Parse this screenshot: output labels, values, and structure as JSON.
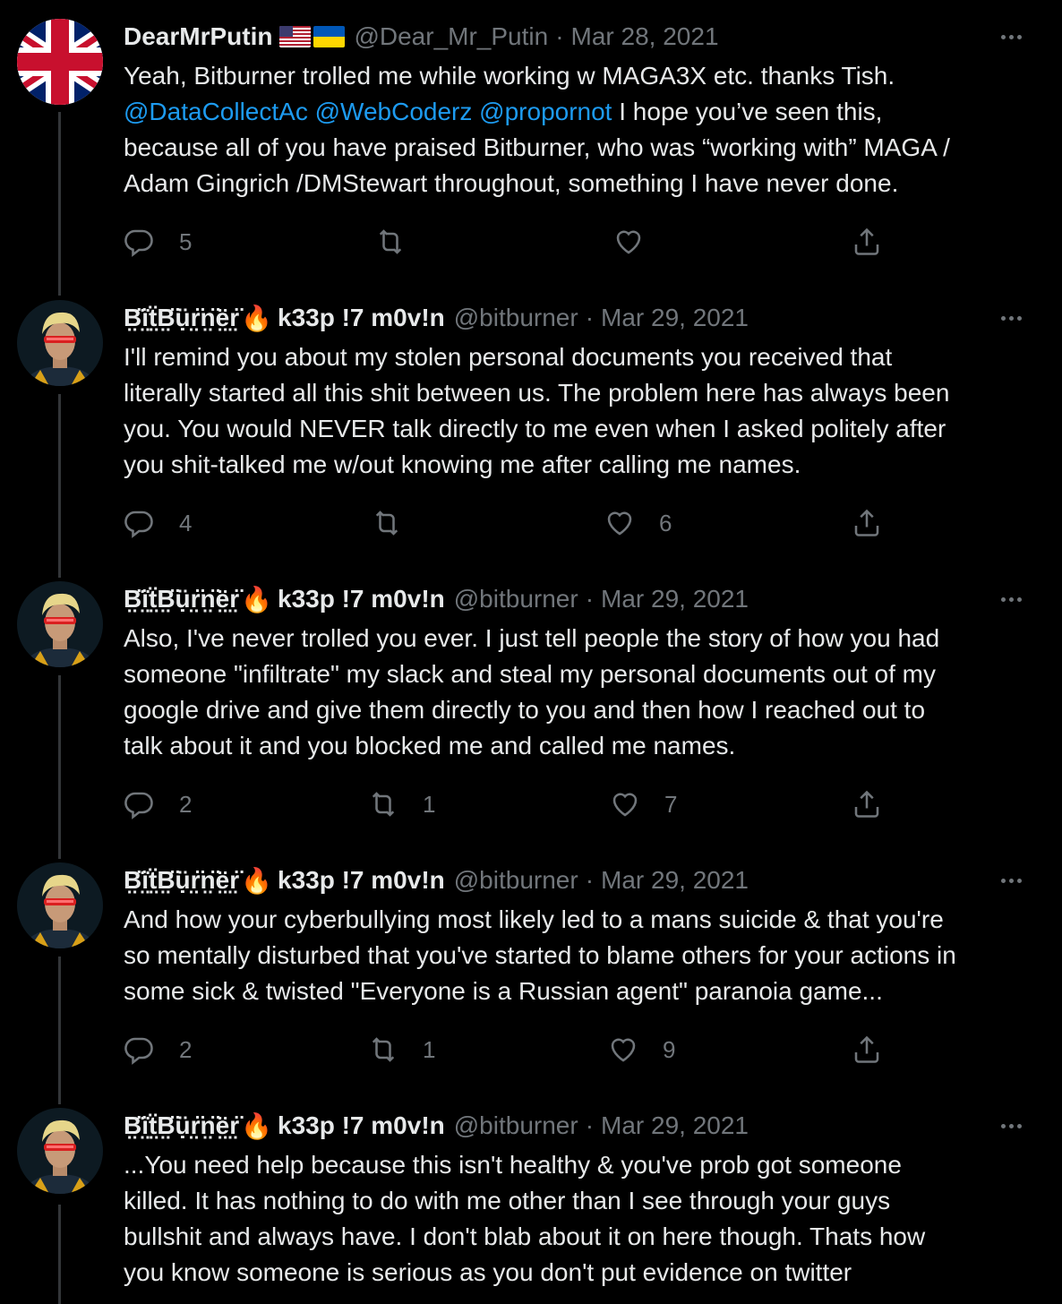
{
  "tweets": [
    {
      "name": "DearMrPutin",
      "handle": "@Dear_Mr_Putin",
      "separator": "·",
      "date": "Mar 28, 2021",
      "avatar": "uk-flag-avatar",
      "flags": [
        "us-flag-icon",
        "ukraine-flag-icon"
      ],
      "text_line1": "Yeah, Bitburner trolled me while working w MAGA3X etc. thanks Tish.",
      "mentions": [
        "@DataCollectAc",
        "@WebCoderz",
        "@propornot"
      ],
      "text_after_mentions": " I hope you’ve seen this,",
      "text_rest": "because all of you have praised Bitburner, who was “working with” MAGA /\nAdam Gingrich /DMStewart throughout, something I have never done.",
      "replies": "5",
      "retweets": "",
      "likes": ""
    },
    {
      "name": "B̤̈ï̤ẗ̤B̤̈ụ̈r̤̈n̤̈ë̤r̤̈",
      "nickname": "k33p !7 m0v!n",
      "handle": "@bitburner",
      "separator": "·",
      "date": "Mar 29, 2021",
      "avatar": "bitburner-avatar",
      "text": "I'll remind you about my stolen personal documents you received that\nliterally started all this shit between us. The problem here has always been\nyou. You would NEVER talk directly to me even when I asked politely after\nyou shit-talked me w/out knowing me after calling me names.",
      "replies": "4",
      "retweets": "",
      "likes": "6"
    },
    {
      "name": "B̤̈ï̤ẗ̤B̤̈ụ̈r̤̈n̤̈ë̤r̤̈",
      "nickname": "k33p !7 m0v!n",
      "handle": "@bitburner",
      "separator": "·",
      "date": "Mar 29, 2021",
      "avatar": "bitburner-avatar",
      "text": "Also, I've never trolled you ever. I just tell people the story of how you had\nsomeone \"infiltrate\" my slack and steal my personal documents out of my\ngoogle drive and give them directly to you and then how I reached out to\ntalk about it and you blocked me and called me names.",
      "replies": "2",
      "retweets": "1",
      "likes": "7"
    },
    {
      "name": "B̤̈ï̤ẗ̤B̤̈ụ̈r̤̈n̤̈ë̤r̤̈",
      "nickname": "k33p !7 m0v!n",
      "handle": "@bitburner",
      "separator": "·",
      "date": "Mar 29, 2021",
      "avatar": "bitburner-avatar",
      "text": "And how your cyberbullying most likely led to a mans suicide & that you're\nso mentally disturbed that you've started to blame others for your actions in\nsome sick & twisted \"Everyone is a Russian agent\" paranoia game...",
      "replies": "2",
      "retweets": "1",
      "likes": "9"
    },
    {
      "name": "B̤̈ï̤ẗ̤B̤̈ụ̈r̤̈n̤̈ë̤r̤̈",
      "nickname": "k33p !7 m0v!n",
      "handle": "@bitburner",
      "separator": "·",
      "date": "Mar 29, 2021",
      "avatar": "bitburner-avatar",
      "text": "...You need help because this isn't healthy & you've prob got someone\nkilled. It has nothing to do with me other than I see through your guys\nbullshit and always have. I don't blab about it on here though. Thats how\nyou know someone is serious as you don't put evidence on twitter"
    }
  ],
  "icons": {
    "reply": "reply-icon",
    "retweet": "retweet-icon",
    "like": "heart-icon",
    "share": "share-icon",
    "more": "more-icon",
    "fire": "🔥"
  },
  "colors": {
    "background": "#000000",
    "text": "#e7e9ea",
    "secondary": "#71767b",
    "link": "#1d9bf0",
    "thread_line": "#333639"
  }
}
